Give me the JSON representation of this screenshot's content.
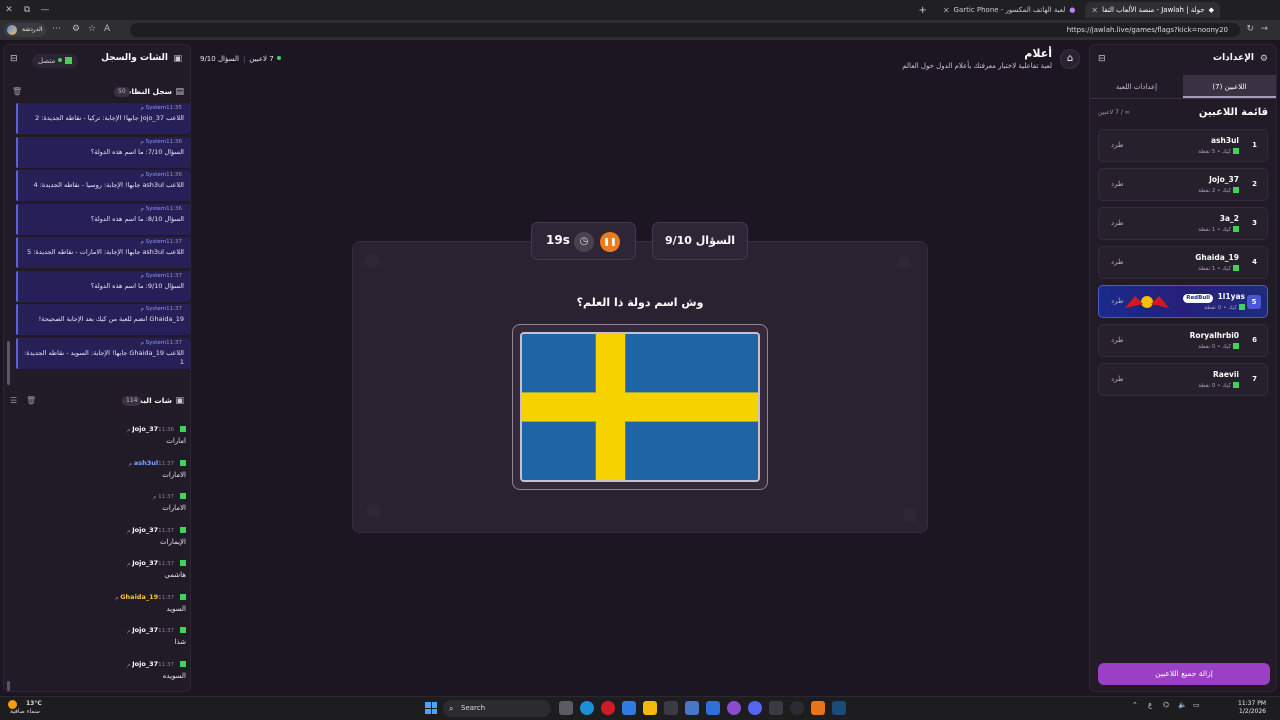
{
  "browser": {
    "tabs": [
      {
        "title": "جولة | Jawlah - منصة الألعاب التفا",
        "active": true
      },
      {
        "title": "لعبة الهاتف المكسور - Gartic Phone",
        "active": false
      }
    ],
    "url": "https://jawlah.live/games/flags?kick=noony20",
    "profile_label": "الدردشة"
  },
  "left_panel": {
    "title": "الشات والسجل",
    "status": "متصل",
    "system_log": {
      "title": "سجل النظام",
      "count": "50",
      "messages": [
        {
          "sender": "System",
          "time": "11:35 م",
          "text": "اللاعب Jojo_37 جابها! الإجابة: تركيا - نقاطه الجديدة: 2"
        },
        {
          "sender": "System",
          "time": "11:36 م",
          "text": "السؤال 7/10: ما اسم هذه الدولة؟"
        },
        {
          "sender": "System",
          "time": "11:36 م",
          "text": "اللاعب ash3ul جابها! الإجابة: روسيا - نقاطه الجديدة: 4"
        },
        {
          "sender": "System",
          "time": "11:36 م",
          "text": "السؤال 8/10: ما اسم هذه الدولة؟"
        },
        {
          "sender": "System",
          "time": "11:37 م",
          "text": "اللاعب ash3ul جابها! الإجابة: الامارات - نقاطه الجديدة: 5"
        },
        {
          "sender": "System",
          "time": "11:37 م",
          "text": "السؤال 9/10: ما اسم هذه الدولة؟"
        },
        {
          "sender": "System",
          "time": "11:37 م",
          "text": "Ghaida_19 انضم للعبة من كيك بعد الإجابة الصحيحة!"
        },
        {
          "sender": "System",
          "time": "11:37 م",
          "text": "اللاعب Ghaida_19 جابها! الإجابة: السويد - نقاطه الجديدة: 1"
        }
      ]
    },
    "stream_chat": {
      "title": "شات البث",
      "count": "114",
      "messages": [
        {
          "user": "Jojo_37",
          "time": "11:36 م",
          "text": "امارات",
          "color": "#ffffff"
        },
        {
          "user": "ash3ul",
          "time": "11:37 م",
          "text": "الامارات",
          "color": "#7aa8ff"
        },
        {
          "user": "",
          "time": "11:37 م",
          "text": "الامارات",
          "color": "#ff5b5b"
        },
        {
          "user": "Jojo_37",
          "time": "11:37 م",
          "text": "الإيمارات",
          "color": "#ffffff"
        },
        {
          "user": "Jojo_37",
          "time": "11:37 م",
          "text": "هاشمي",
          "color": "#ffffff"
        },
        {
          "user": "Ghaida_19",
          "time": "11:37 م",
          "text": "السويد",
          "color": "#f5c542"
        },
        {
          "user": "Jojo_37",
          "time": "11:37 م",
          "text": "شذا",
          "color": "#ffffff"
        },
        {
          "user": "Jojo_37",
          "time": "11:37 م",
          "text": "السويده",
          "color": "#ffffff"
        }
      ]
    }
  },
  "center": {
    "game_title": "أعلام",
    "game_subtitle": "لعبة تفاعلية لاختبار معرفتك بأعلام الدول حول العالم",
    "players_online": "7 لاعبين",
    "question_progress": "السؤال 9/10",
    "question_label": "السؤال 9/10",
    "timer": "19s",
    "question_text": "وش اسم دولة ذا العلم؟",
    "flag": {
      "name": "Sweden",
      "blue": "#1f65a6",
      "yellow": "#f5d200"
    }
  },
  "right_panel": {
    "title": "الإعدادات",
    "tabs": [
      "اللاعبين (7)",
      "إعدادات اللعبة"
    ],
    "players_title": "قائمة اللاعبين",
    "players_count": "∞ / 7 لاعبين",
    "kick_label": "طرد",
    "players": [
      {
        "rank": "1",
        "name": "ash3ul",
        "points": "5 نقطة",
        "platform": "كيك"
      },
      {
        "rank": "2",
        "name": "Jojo_37",
        "points": "2 نقطة",
        "platform": "كيك"
      },
      {
        "rank": "3",
        "name": "3a_2",
        "points": "1 نقطة",
        "platform": "كيك"
      },
      {
        "rank": "4",
        "name": "Ghaida_19",
        "points": "1 نقطة",
        "platform": "كيك"
      },
      {
        "rank": "5",
        "name": "1l1yas",
        "points": "0 نقطة",
        "platform": "كيك",
        "badge": "RedBull"
      },
      {
        "rank": "6",
        "name": "Roryalhrbi0",
        "points": "0 نقطة",
        "platform": "كيك"
      },
      {
        "rank": "7",
        "name": "Raevii",
        "points": "0 نقطة",
        "platform": "كيك"
      }
    ],
    "remove_all": "إزالة جميع اللاعبين"
  },
  "taskbar": {
    "weather_temp": "13°C",
    "weather_desc": "سماء صافية",
    "search_placeholder": "Search",
    "time": "11:37 PM",
    "date": "1/2/2026",
    "lang": "ع"
  }
}
